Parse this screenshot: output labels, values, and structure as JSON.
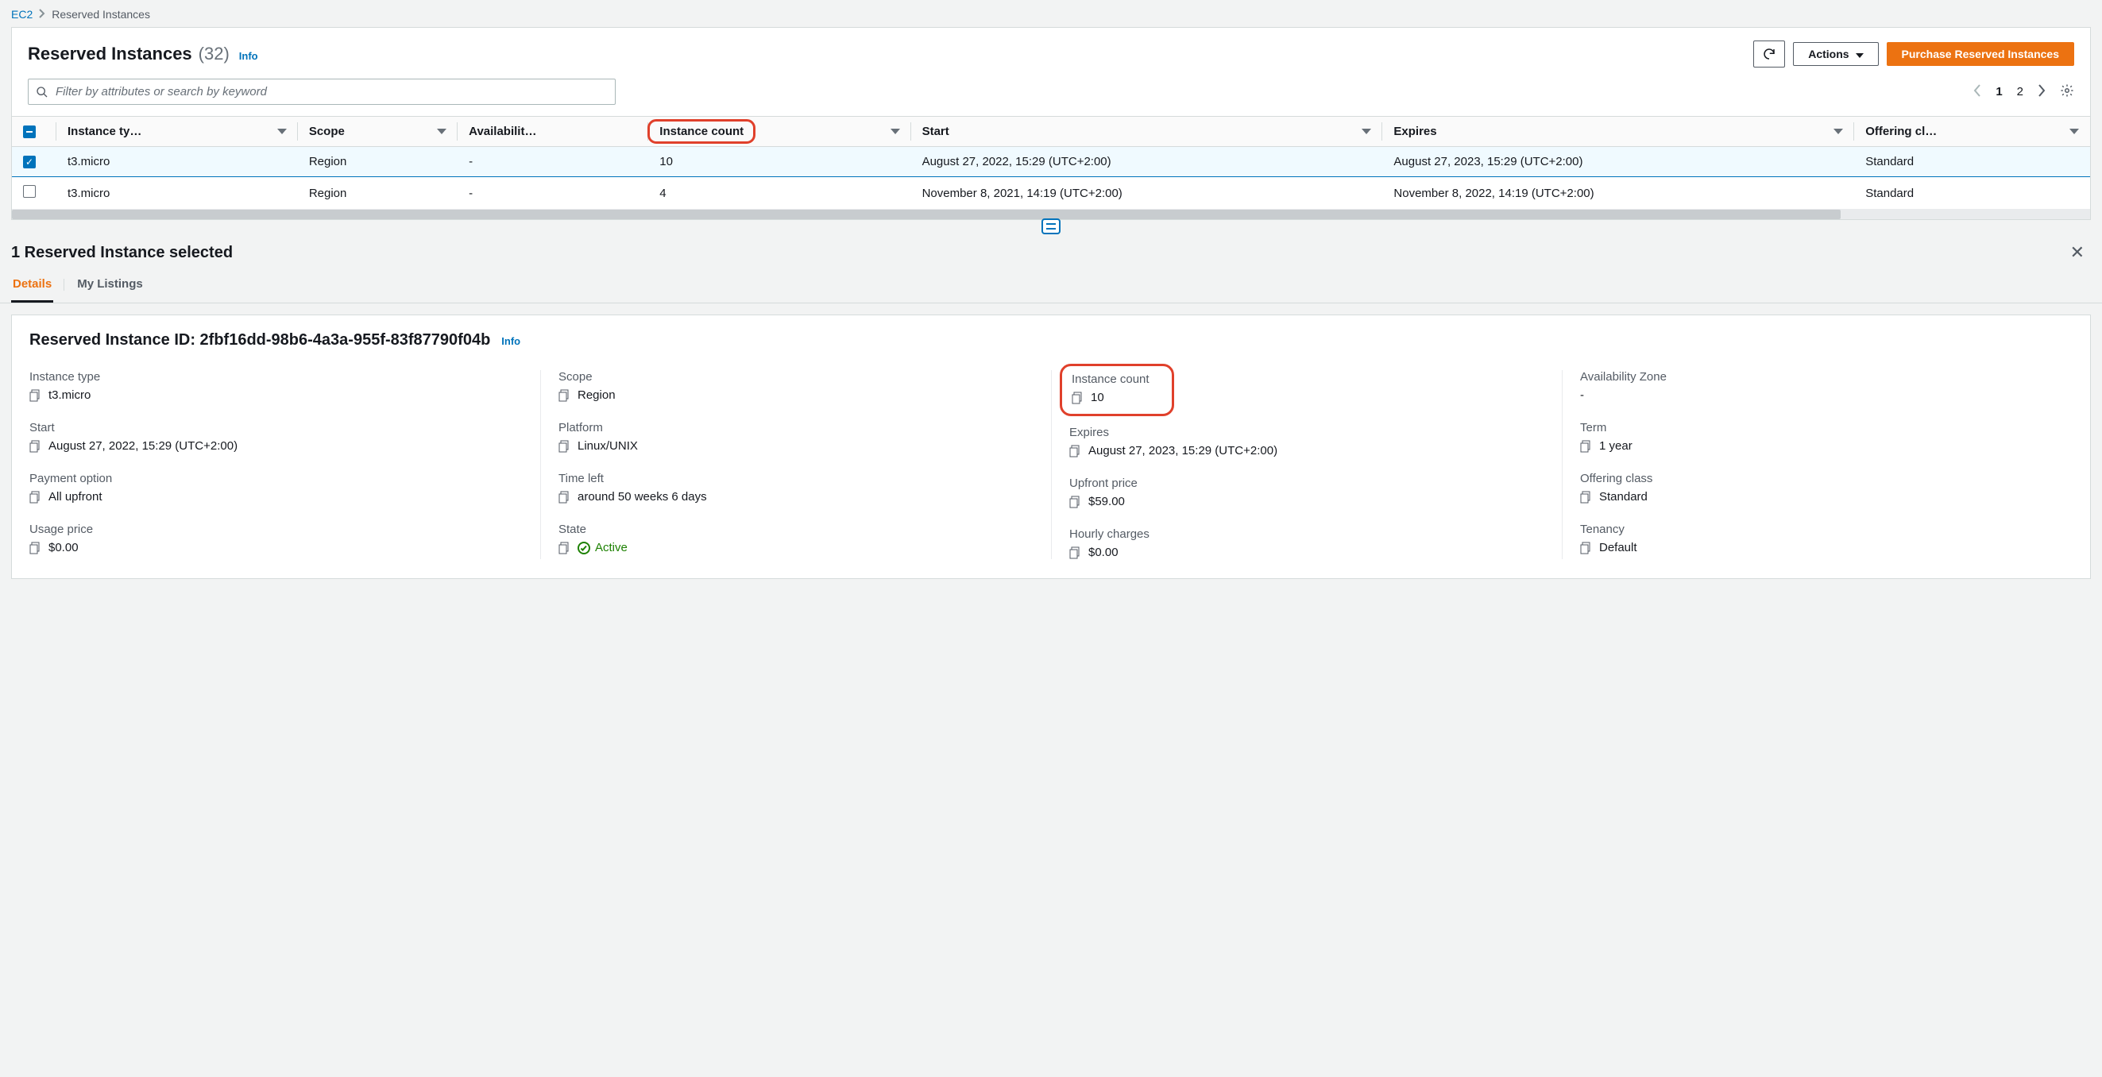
{
  "breadcrumb": {
    "root": "EC2",
    "current": "Reserved Instances"
  },
  "header": {
    "title": "Reserved Instances",
    "count": "(32)",
    "info": "Info",
    "actions_label": "Actions",
    "purchase_label": "Purchase Reserved Instances"
  },
  "search": {
    "placeholder": "Filter by attributes or search by keyword"
  },
  "pager": {
    "pages": [
      "1",
      "2"
    ]
  },
  "columns": {
    "c0": "Instance ty…",
    "c1": "Scope",
    "c2": "Availabilit…",
    "c3": "Instance count",
    "c4": "Start",
    "c5": "Expires",
    "c6": "Offering cl…"
  },
  "rows": [
    {
      "selected": true,
      "type": "t3.micro",
      "scope": "Region",
      "az": "-",
      "count": "10",
      "start": "August 27, 2022, 15:29 (UTC+2:00)",
      "expires": "August 27, 2023, 15:29 (UTC+2:00)",
      "offering": "Standard"
    },
    {
      "selected": false,
      "type": "t3.micro",
      "scope": "Region",
      "az": "-",
      "count": "4",
      "start": "November 8, 2021, 14:19 (UTC+2:00)",
      "expires": "November 8, 2022, 14:19 (UTC+2:00)",
      "offering": "Standard"
    }
  ],
  "split": {
    "title": "1 Reserved Instance selected",
    "tabs": {
      "details": "Details",
      "listings": "My Listings"
    }
  },
  "detail": {
    "title_prefix": "Reserved Instance ID:",
    "id": "2fbf16dd-98b6-4a3a-955f-83f87790f04b",
    "info": "Info",
    "labels": {
      "instance_type": "Instance type",
      "scope": "Scope",
      "instance_count": "Instance count",
      "az": "Availability Zone",
      "start": "Start",
      "platform": "Platform",
      "expires": "Expires",
      "term": "Term",
      "payment_option": "Payment option",
      "time_left": "Time left",
      "upfront": "Upfront price",
      "offering_class": "Offering class",
      "usage_price": "Usage price",
      "state": "State",
      "hourly": "Hourly charges",
      "tenancy": "Tenancy"
    },
    "values": {
      "instance_type": "t3.micro",
      "scope": "Region",
      "instance_count": "10",
      "az": "-",
      "start": "August 27, 2022, 15:29 (UTC+2:00)",
      "platform": "Linux/UNIX",
      "expires": "August 27, 2023, 15:29 (UTC+2:00)",
      "term": "1 year",
      "payment_option": "All upfront",
      "time_left": "around 50 weeks 6 days",
      "upfront": "$59.00",
      "offering_class": "Standard",
      "usage_price": "$0.00",
      "state": "Active",
      "hourly": "$0.00",
      "tenancy": "Default"
    }
  }
}
